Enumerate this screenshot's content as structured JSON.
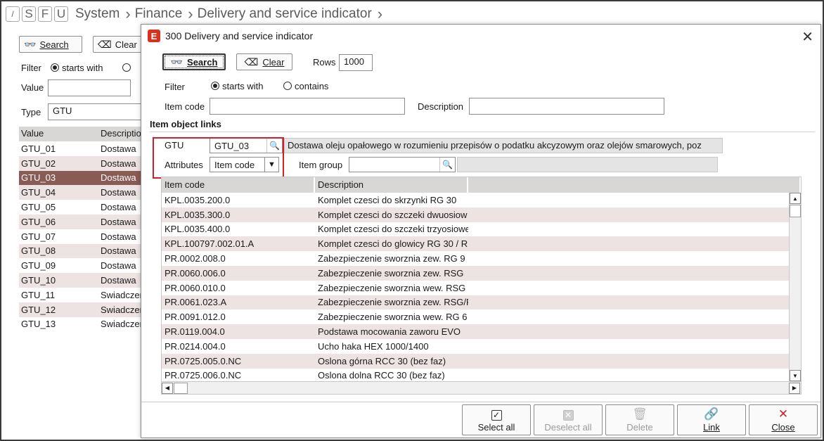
{
  "topbar": {
    "buttons": [
      "/",
      "S",
      "F",
      "U"
    ],
    "breadcrumb": [
      "System",
      "Finance",
      "Delivery and service indicator"
    ]
  },
  "background": {
    "search_label": "Search",
    "clear_label": "Clear",
    "filter_label": "Filter",
    "starts_with": "starts with",
    "value_label": "Value",
    "type_label": "Type",
    "type_value": "GTU",
    "columns": [
      "Value",
      "Descriptio"
    ],
    "rows": [
      [
        "GTU_01",
        "Dostawa"
      ],
      [
        "GTU_02",
        "Dostawa"
      ],
      [
        "GTU_03",
        "Dostawa"
      ],
      [
        "GTU_04",
        "Dostawa"
      ],
      [
        "GTU_05",
        "Dostawa"
      ],
      [
        "GTU_06",
        "Dostawa"
      ],
      [
        "GTU_07",
        "Dostawa"
      ],
      [
        "GTU_08",
        "Dostawa"
      ],
      [
        "GTU_09",
        "Dostawa"
      ],
      [
        "GTU_10",
        "Dostawa"
      ],
      [
        "GTU_11",
        "Swiadczer"
      ],
      [
        "GTU_12",
        "Swiadczer"
      ],
      [
        "GTU_13",
        "Swiadczer"
      ]
    ]
  },
  "dialog": {
    "app_icon": "E",
    "title": "300 Delivery and service indicator",
    "search_label": "Search",
    "clear_label": "Clear",
    "rows_label": "Rows",
    "rows_value": "1000",
    "filter_label": "Filter",
    "starts_with": "starts with",
    "contains": "contains",
    "item_code_label": "Item code",
    "description_label": "Description",
    "section_title": "Item object links",
    "gtu_label": "GTU",
    "gtu_value": "GTU_03",
    "gtu_description": "Dostawa oleju opałowego w rozumieniu przepisów o podatku akcyzowym oraz olejów smarowych, poz",
    "attributes_label": "Attributes",
    "attributes_value": "Item code",
    "item_group_label": "Item group",
    "grid_columns": [
      "Item code",
      "Description"
    ],
    "grid_rows": [
      [
        "KPL.0035.200.0",
        "Komplet czesci do skrzynki RG 30"
      ],
      [
        "KPL.0035.300.0",
        "Komplet czesci do szczeki dwuosiow"
      ],
      [
        "KPL.0035.400.0",
        "Komplet czesci do szczeki trzyosiowe"
      ],
      [
        "KPL.100797.002.01.A",
        "Komplet czesci do glowicy RG 30 / R"
      ],
      [
        "PR.0002.008.0",
        "Zabezpieczenie sworznia zew. RG 9"
      ],
      [
        "PR.0060.006.0",
        "Zabezpieczenie sworznia zew. RSG"
      ],
      [
        "PR.0060.010.0",
        "Zabezpieczenie sworznia wew. RSG"
      ],
      [
        "PR.0061.023.A",
        "Zabezpieczenie sworznia zew. RSG/R"
      ],
      [
        "PR.0091.012.0",
        "Zabezpieczenie sworznia wew. RG 6"
      ],
      [
        "PR.0119.004.0",
        "Podstawa mocowania zaworu EVO"
      ],
      [
        "PR.0214.004.0",
        "Ucho haka HEX 1000/1400"
      ],
      [
        "PR.0725.005.0.NC",
        "Oslona górna RCC 30 (bez faz)"
      ],
      [
        "PR.0725.006.0.NC",
        "Oslona dolna RCC 30 (bez faz)"
      ]
    ],
    "footer": {
      "select_all": "Select all",
      "deselect_all": "Deselect all",
      "delete": "Delete",
      "link": "Link",
      "close": "Close"
    }
  },
  "colors": {
    "selected_row": "#8a5a55",
    "alt_row": "#ece3e2",
    "header": "#d9d6d6",
    "highlight_box": "#d0202a",
    "app_icon": "#d6321f"
  },
  "icons": [
    "binoculars-icon",
    "eraser-icon",
    "lookup-icon",
    "dropdown-arrow-icon",
    "checkbox-icon",
    "trash-icon",
    "link-icon",
    "close-icon"
  ]
}
